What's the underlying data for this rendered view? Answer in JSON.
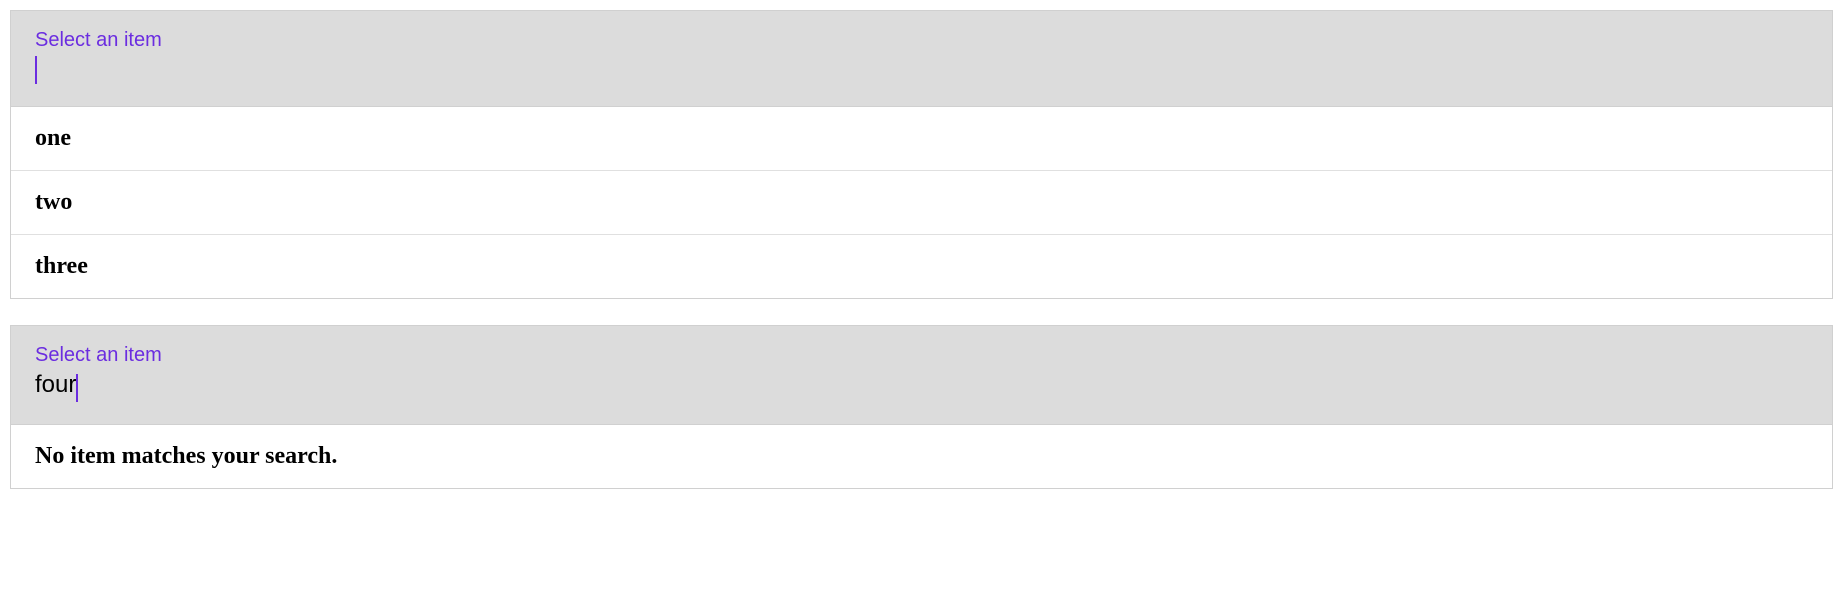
{
  "autocomplete1": {
    "label": "Select an item",
    "value": "",
    "options": [
      {
        "label": "one"
      },
      {
        "label": "two"
      },
      {
        "label": "three"
      }
    ]
  },
  "autocomplete2": {
    "label": "Select an item",
    "value": "four",
    "no_results_message": "No item matches your search."
  }
}
